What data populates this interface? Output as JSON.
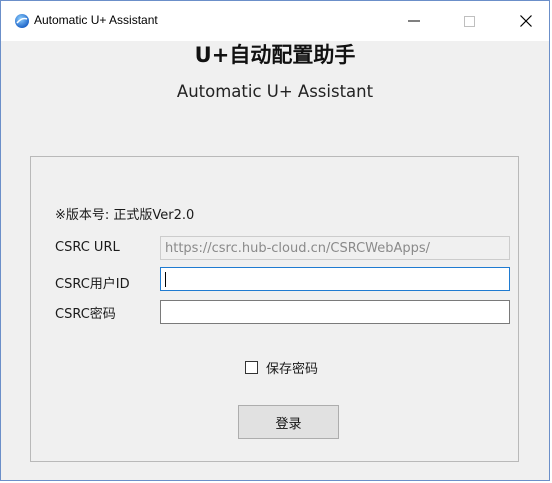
{
  "window": {
    "title": "Automatic U+ Assistant",
    "minimize_label": "—",
    "close_label": "X"
  },
  "header": {
    "title_cn": "U+自动配置助手",
    "title_en": "Automatic U+ Assistant"
  },
  "form": {
    "version": "※版本号: 正式版Ver2.0",
    "url_label": "CSRC URL",
    "url_value": "https://csrc.hub-cloud.cn/CSRCWebApps/",
    "user_label": "CSRC用户ID",
    "user_value": "",
    "password_label": "CSRC密码",
    "password_value": "",
    "remember_label": "保存密码",
    "remember_checked": false,
    "login_label": "登录"
  },
  "colors": {
    "accent": "#1f7bd1",
    "window_border": "#6b8fc9",
    "panel_bg": "#f0f0f0"
  }
}
